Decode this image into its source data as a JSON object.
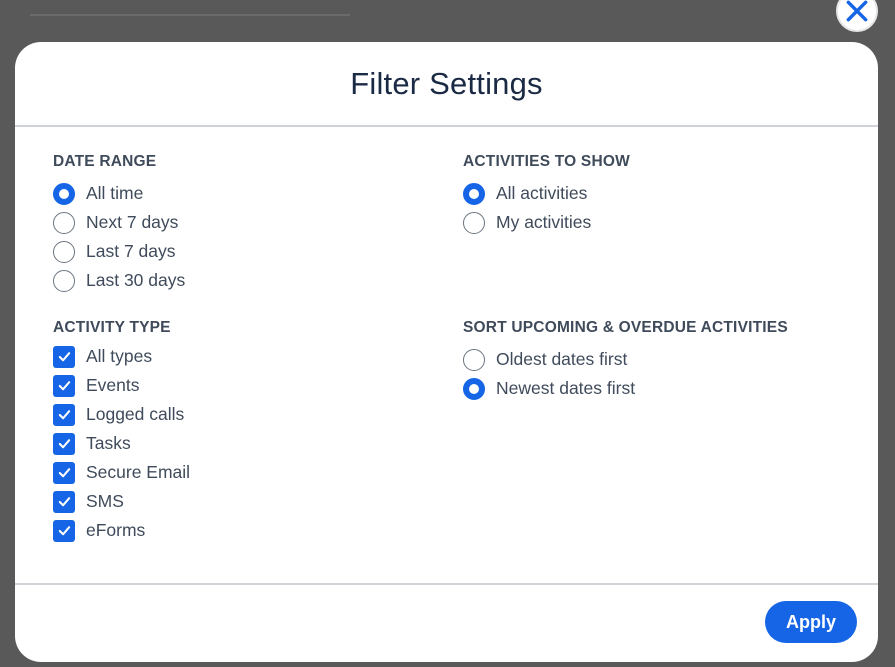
{
  "modal": {
    "title": "Filter Settings",
    "close_icon": "close-icon",
    "apply_label": "Apply"
  },
  "date_range": {
    "title": "DATE RANGE",
    "options": [
      {
        "label": "All time",
        "selected": true
      },
      {
        "label": "Next 7 days",
        "selected": false
      },
      {
        "label": "Last 7 days",
        "selected": false
      },
      {
        "label": "Last 30 days",
        "selected": false
      }
    ]
  },
  "activities_to_show": {
    "title": "ACTIVITIES TO SHOW",
    "options": [
      {
        "label": "All activities",
        "selected": true
      },
      {
        "label": "My activities",
        "selected": false
      }
    ]
  },
  "activity_type": {
    "title": "ACTIVITY TYPE",
    "options": [
      {
        "label": "All types",
        "checked": true
      },
      {
        "label": "Events",
        "checked": true
      },
      {
        "label": "Logged calls",
        "checked": true
      },
      {
        "label": "Tasks",
        "checked": true
      },
      {
        "label": "Secure Email",
        "checked": true
      },
      {
        "label": "SMS",
        "checked": true
      },
      {
        "label": "eForms",
        "checked": true
      }
    ]
  },
  "sort": {
    "title": "SORT UPCOMING & OVERDUE ACTIVITIES",
    "options": [
      {
        "label": "Oldest dates first",
        "selected": false
      },
      {
        "label": "Newest dates first",
        "selected": true
      }
    ]
  },
  "colors": {
    "accent": "#1565e6",
    "text": "#3f4b5b",
    "title": "#1b2a44",
    "backdrop": "#595959"
  }
}
